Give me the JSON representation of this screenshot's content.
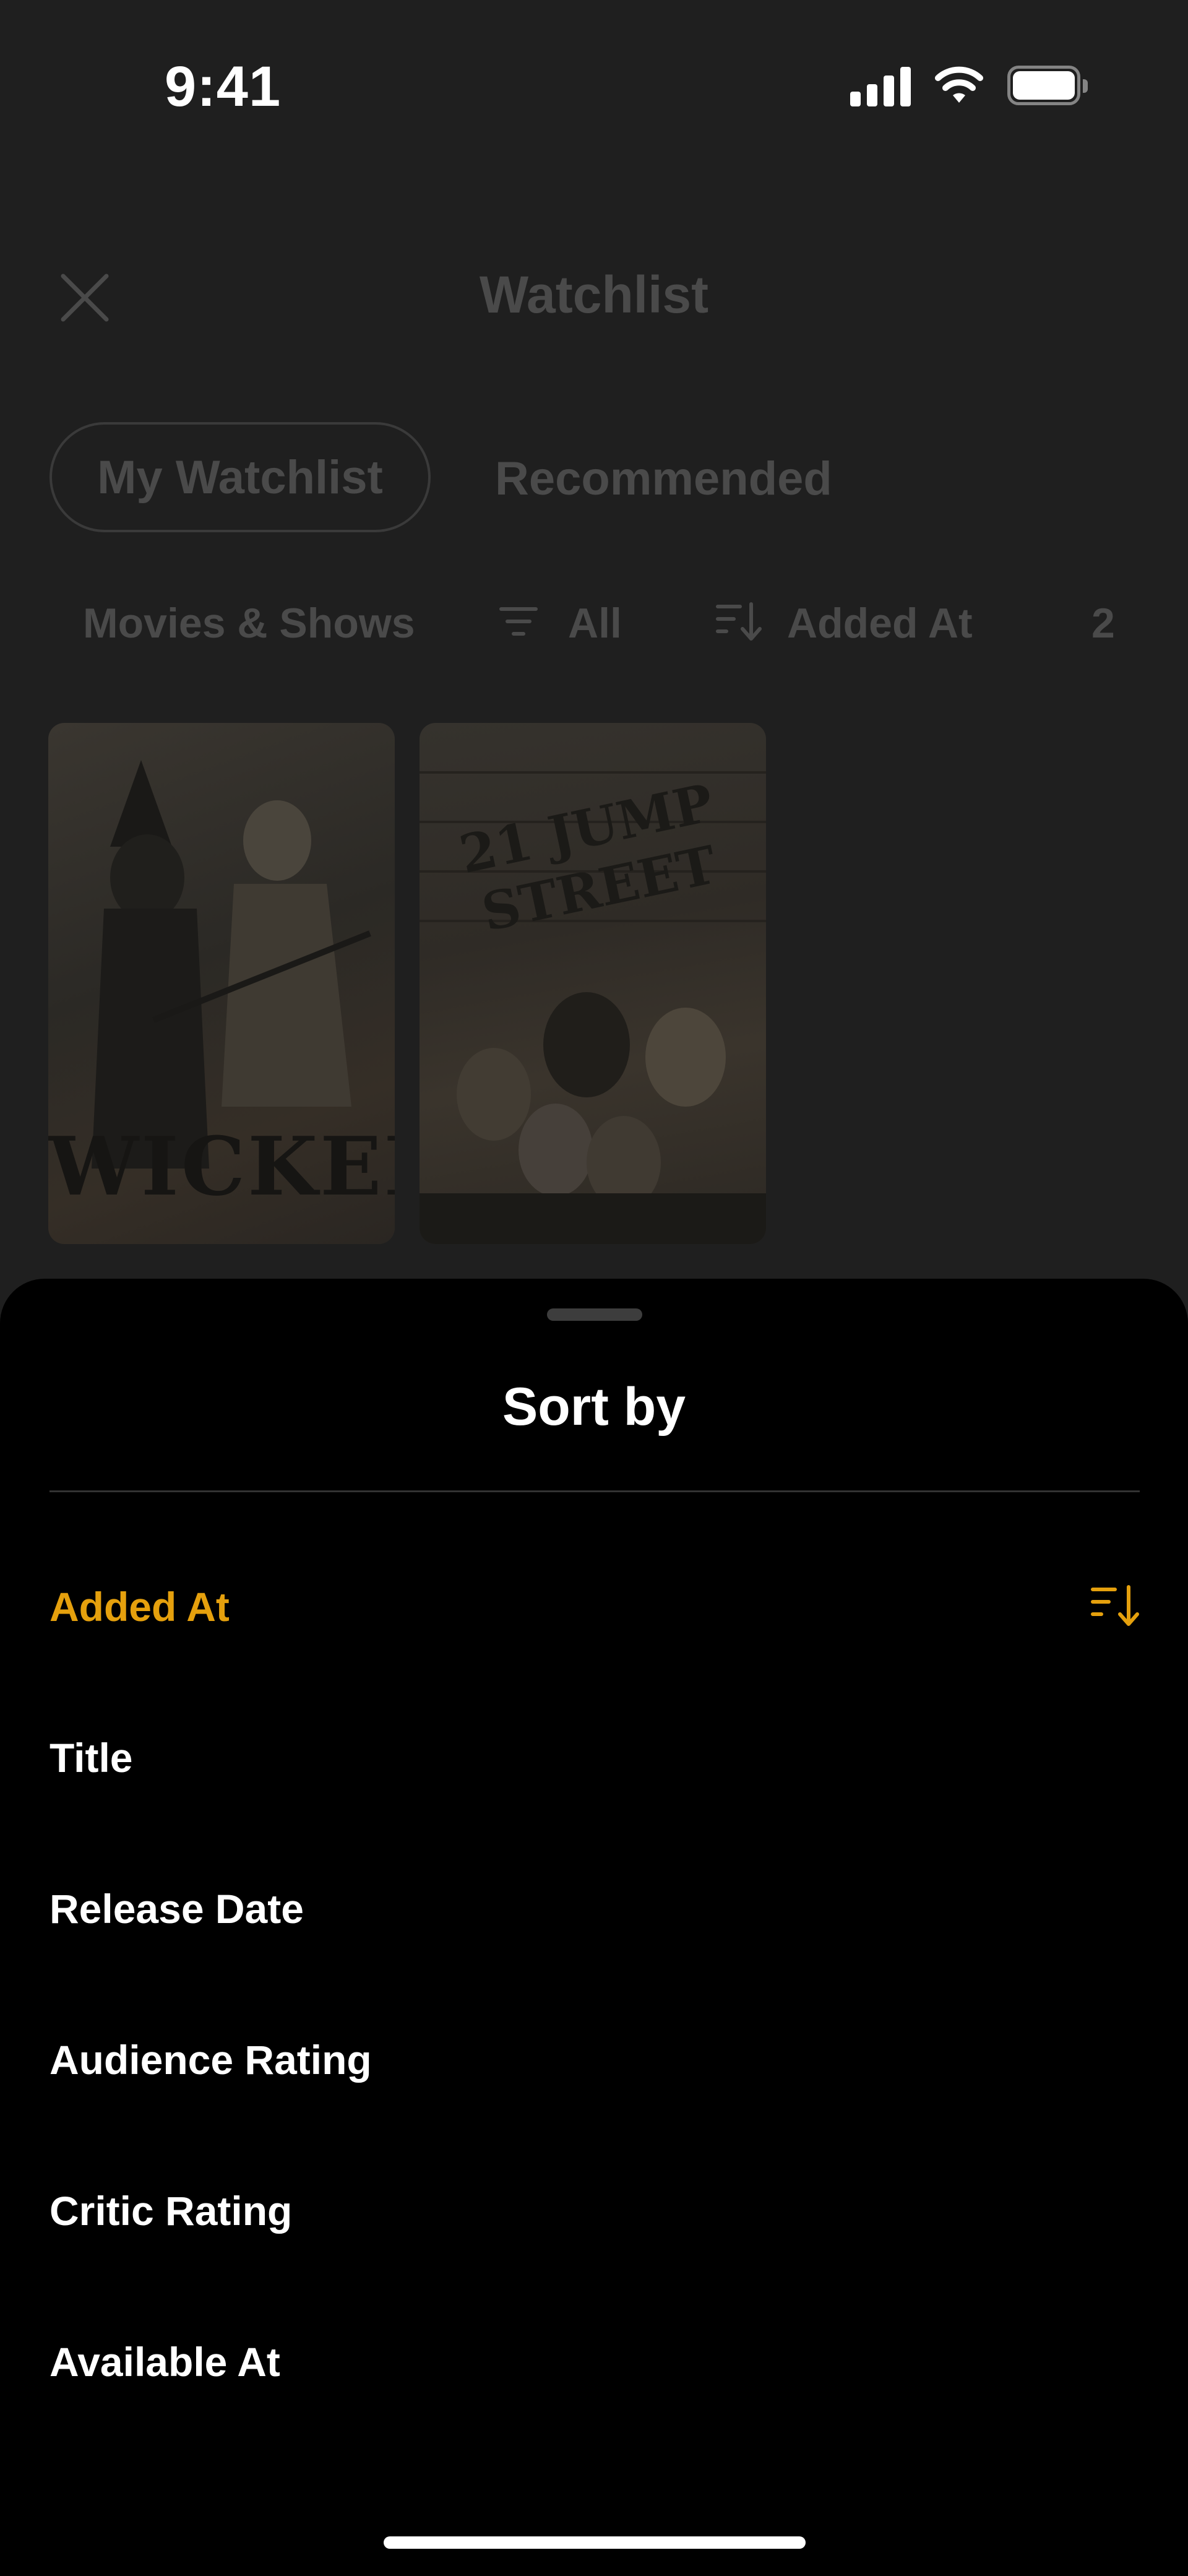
{
  "status_bar": {
    "time": "9:41"
  },
  "header": {
    "title": "Watchlist"
  },
  "tabs": [
    {
      "label": "My Watchlist",
      "selected": true
    },
    {
      "label": "Recommended",
      "selected": false
    }
  ],
  "filters": {
    "type_label": "Movies & Shows",
    "filter_label": "All",
    "sort_label": "Added At",
    "count": "2"
  },
  "posters": [
    {
      "title": "WICKED"
    },
    {
      "title": "21 JUMP STREET"
    }
  ],
  "sheet": {
    "title": "Sort by",
    "options": [
      {
        "label": "Added At",
        "selected": true
      },
      {
        "label": "Title",
        "selected": false
      },
      {
        "label": "Release Date",
        "selected": false
      },
      {
        "label": "Audience Rating",
        "selected": false
      },
      {
        "label": "Critic Rating",
        "selected": false
      },
      {
        "label": "Available At",
        "selected": false
      }
    ]
  },
  "colors": {
    "accent": "#e5a00d",
    "sheet_bg": "#000000",
    "backdrop": "#1f1f1f"
  }
}
